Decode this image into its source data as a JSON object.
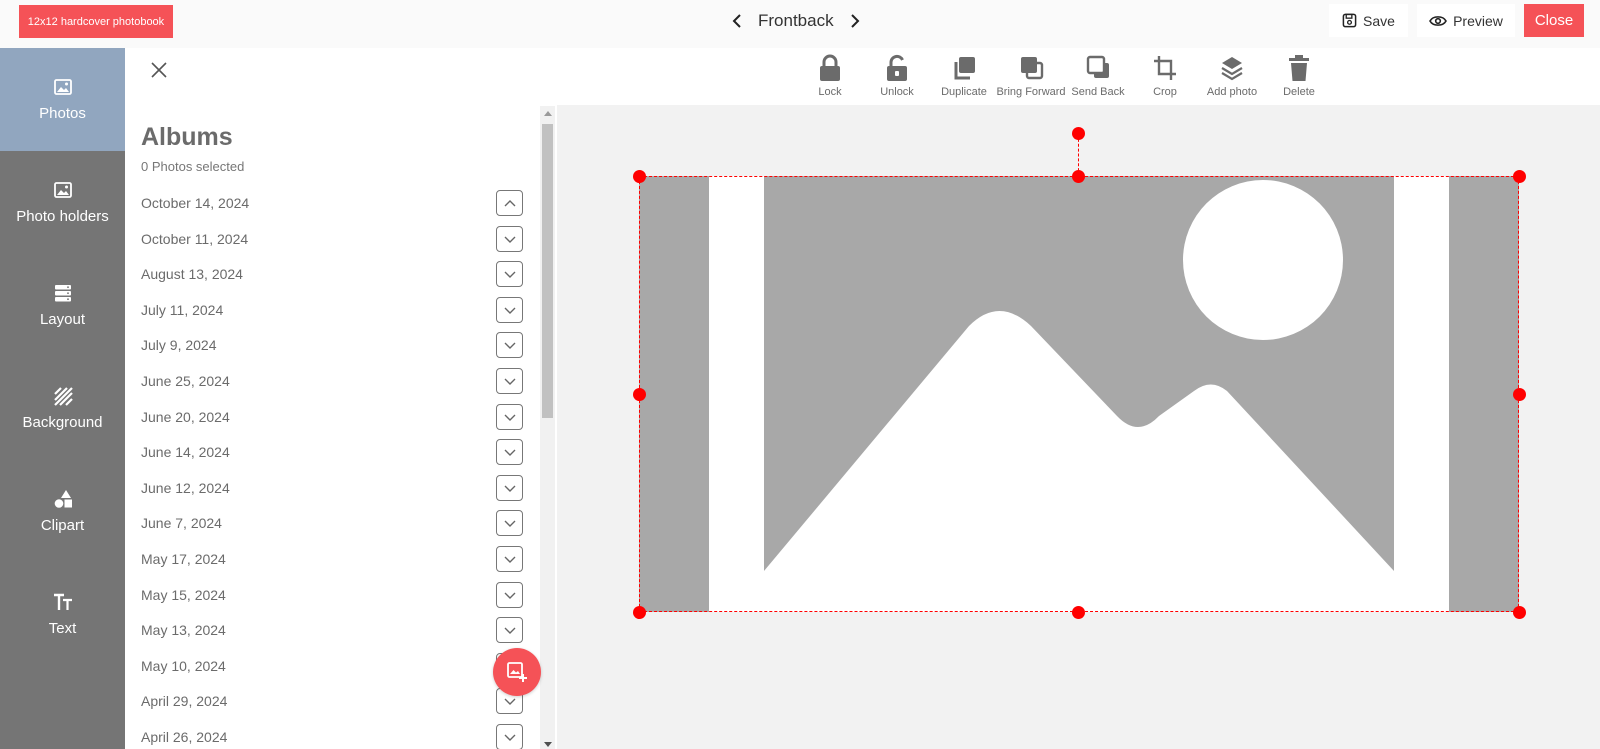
{
  "header": {
    "product_label": "12x12 hardcover photobook",
    "page_title": "Frontback",
    "save_label": "Save",
    "preview_label": "Preview",
    "close_label": "Close"
  },
  "leftnav": {
    "items": [
      {
        "label": "Photos",
        "icon": "photo-icon",
        "active": true
      },
      {
        "label": "Photo holders",
        "icon": "photo-holder-icon",
        "active": false
      },
      {
        "label": "Layout",
        "icon": "layout-icon",
        "active": false
      },
      {
        "label": "Background",
        "icon": "background-stripes-icon",
        "active": false
      },
      {
        "label": "Clipart",
        "icon": "shapes-icon",
        "active": false
      },
      {
        "label": "Text",
        "icon": "text-size-icon",
        "active": false
      }
    ]
  },
  "albums": {
    "title": "Albums",
    "selected_text": "0 Photos selected",
    "items": [
      {
        "date": "October 14, 2024",
        "expanded": true
      },
      {
        "date": "October 11, 2024",
        "expanded": false
      },
      {
        "date": "August 13, 2024",
        "expanded": false
      },
      {
        "date": "July 11, 2024",
        "expanded": false
      },
      {
        "date": "July 9, 2024",
        "expanded": false
      },
      {
        "date": "June 25, 2024",
        "expanded": false
      },
      {
        "date": "June 20, 2024",
        "expanded": false
      },
      {
        "date": "June 14, 2024",
        "expanded": false
      },
      {
        "date": "June 12, 2024",
        "expanded": false
      },
      {
        "date": "June 7, 2024",
        "expanded": false
      },
      {
        "date": "May 17, 2024",
        "expanded": false
      },
      {
        "date": "May 15, 2024",
        "expanded": false
      },
      {
        "date": "May 13, 2024",
        "expanded": false
      },
      {
        "date": "May 10, 2024",
        "expanded": false
      },
      {
        "date": "April 29, 2024",
        "expanded": false
      },
      {
        "date": "April 26, 2024",
        "expanded": false
      }
    ]
  },
  "toolbar": {
    "tools": [
      {
        "label": "Lock",
        "icon": "lock-icon"
      },
      {
        "label": "Unlock",
        "icon": "unlock-icon"
      },
      {
        "label": "Duplicate",
        "icon": "duplicate-icon"
      },
      {
        "label": "Bring Forward",
        "icon": "bring-forward-icon"
      },
      {
        "label": "Send Back",
        "icon": "send-back-icon"
      },
      {
        "label": "Crop",
        "icon": "crop-icon"
      },
      {
        "label": "Add photo",
        "icon": "layers-icon"
      },
      {
        "label": "Delete",
        "icon": "trash-icon"
      }
    ]
  },
  "colors": {
    "accent": "#f55257",
    "nav_bg": "#757575",
    "nav_active": "#91a6bf",
    "canvas_bg": "#f2f2f2",
    "placeholder_gray": "#a8a8a8",
    "selection_red": "#ff0000"
  }
}
